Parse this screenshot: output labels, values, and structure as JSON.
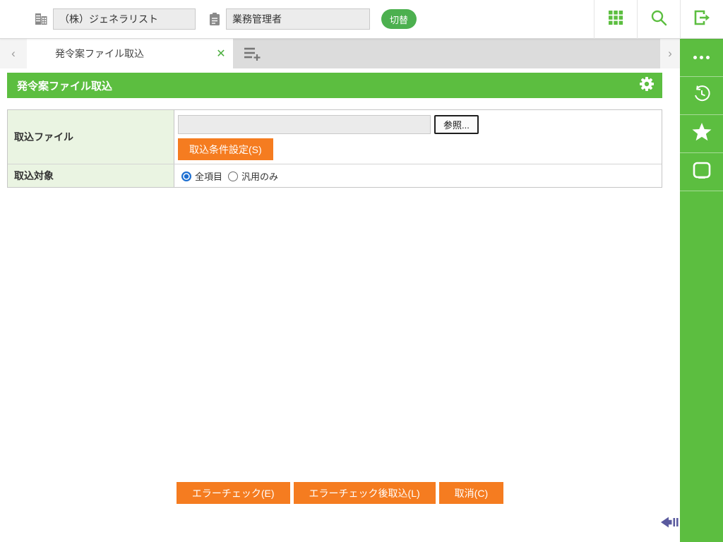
{
  "header": {
    "company_value": "（株）ジェネラリスト",
    "role_value": "業務管理者",
    "switch_label": "切替"
  },
  "tabbar": {
    "prev_label": "‹",
    "next_label": "›",
    "active_tab": "発令案ファイル取込",
    "close_label": "✕"
  },
  "titlebar": {
    "title": "発令案ファイル取込"
  },
  "form": {
    "rows": [
      {
        "label": "取込ファイル"
      },
      {
        "label": "取込対象"
      }
    ],
    "file_value": "",
    "browse_label": "参照...",
    "condition_button": "取込条件設定(S)",
    "radio_options": [
      {
        "label": "全項目",
        "checked": true
      },
      {
        "label": "汎用のみ",
        "checked": false
      }
    ]
  },
  "actions": {
    "error_check": "エラーチェック(E)",
    "error_check_import": "エラーチェック後取込(L)",
    "cancel": "取消(C)"
  },
  "icons": [
    "building-icon",
    "clipboard-icon",
    "apps-grid-icon",
    "search-icon",
    "logout-icon",
    "add-tab-icon",
    "gear-icon",
    "more-ellipsis-icon",
    "history-icon",
    "star-icon",
    "tray-icon",
    "collapse-panel-icon"
  ],
  "colors": {
    "brand_green": "#5cbe40",
    "switch_green": "#4cb04f",
    "accent_orange": "#f57c20",
    "label_cell_green": "#eaf4e2",
    "radio_blue": "#1d6fd1",
    "collapse_purple": "#5a5a9e"
  }
}
